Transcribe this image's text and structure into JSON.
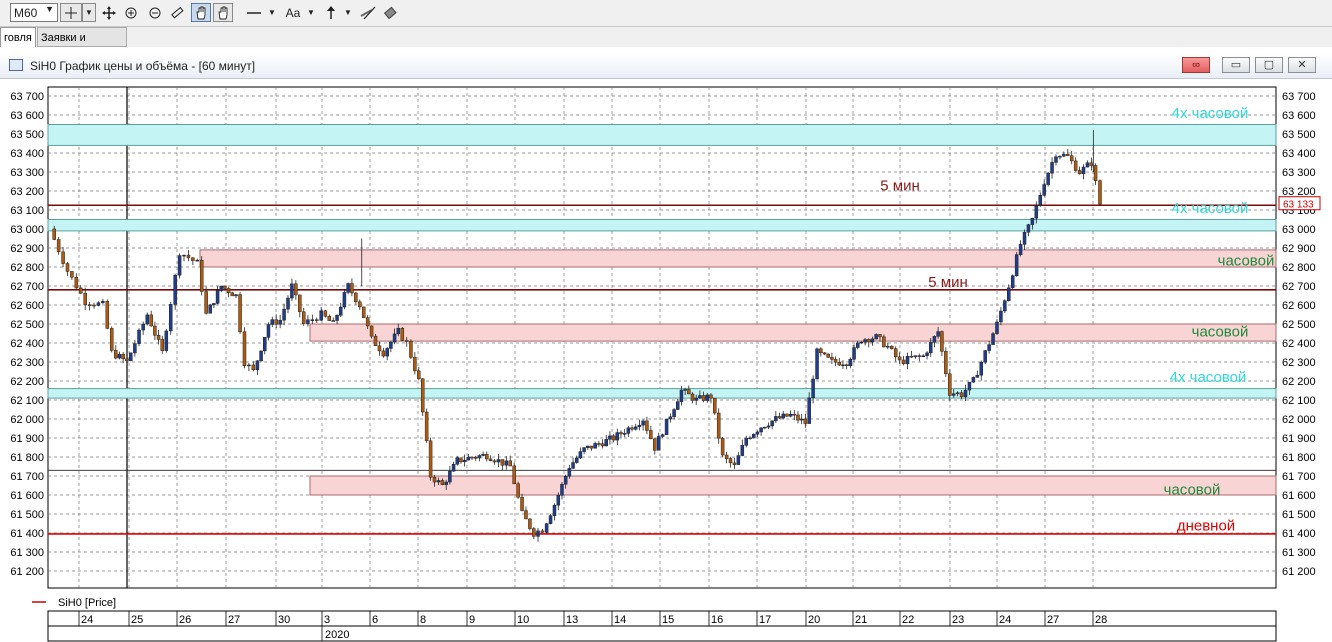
{
  "toolbar": {
    "interval": "M60",
    "text_tool": "Aa"
  },
  "tabs": [
    {
      "label": "говля"
    },
    {
      "label": "Заявки и сделки"
    }
  ],
  "window": {
    "title": "SiH0 График цены и объёма - [60 минут]"
  },
  "legend": {
    "label": "SiH0 [Price]",
    "color": "#cc0000"
  },
  "colors": {
    "hourly_zone_fill": "#f9d4d4",
    "four_hour_zone_fill": "#c5f4f4",
    "hourly_label": "#1e8a3e",
    "four_hour_label": "#2fd9d9",
    "five_min_label": "#8a1a1a",
    "daily_label": "#e00000",
    "bull_candle": "#1f3d8c",
    "bear_candle": "#b05a10",
    "price_badge": "#cc0000"
  },
  "chart_data": {
    "type": "candlestick",
    "title": "SiH0 График цены и объёма - [60 минут]",
    "series_name": "SiH0 [Price]",
    "ylim": [
      61100,
      63750
    ],
    "y_ticks": [
      "63 700",
      "63 600",
      "63 500",
      "63 400",
      "63 300",
      "63 200",
      "63 100",
      "63 000",
      "62 900",
      "62 800",
      "62 700",
      "62 600",
      "62 500",
      "62 400",
      "62 300",
      "62 200",
      "62 100",
      "62 000",
      "61 900",
      "61 800",
      "61 700",
      "61 600",
      "61 500",
      "61 400",
      "61 300",
      "61 200"
    ],
    "y_tick_values": [
      63700,
      63600,
      63500,
      63400,
      63300,
      63200,
      63100,
      63000,
      62900,
      62800,
      62700,
      62600,
      62500,
      62400,
      62300,
      62200,
      62100,
      62000,
      61900,
      61800,
      61700,
      61600,
      61500,
      61400,
      61300,
      61200
    ],
    "x_day_labels": [
      "24",
      "25",
      "26",
      "27",
      "30",
      "3",
      "6",
      "8",
      "9",
      "10",
      "13",
      "14",
      "15",
      "16",
      "17",
      "20",
      "21",
      "22",
      "23",
      "24",
      "27",
      "28"
    ],
    "x_year_label": "2020",
    "last_price": "63 133",
    "last_price_value": 63133,
    "close_path": [
      [
        0,
        63000
      ],
      [
        0.6,
        62780
      ],
      [
        1.2,
        62620
      ],
      [
        1.8,
        62600
      ],
      [
        2.1,
        62350
      ],
      [
        2.6,
        62300
      ],
      [
        3.3,
        62550
      ],
      [
        3.8,
        62350
      ],
      [
        4.4,
        62880
      ],
      [
        5.0,
        62820
      ],
      [
        5.3,
        62550
      ],
      [
        5.8,
        62700
      ],
      [
        6.3,
        62650
      ],
      [
        6.6,
        62300
      ],
      [
        6.9,
        62250
      ],
      [
        7.4,
        62500
      ],
      [
        7.8,
        62520
      ],
      [
        8.2,
        62700
      ],
      [
        8.6,
        62500
      ],
      [
        9.2,
        62550
      ],
      [
        9.6,
        62500
      ],
      [
        10.1,
        62700
      ],
      [
        10.5,
        62600
      ],
      [
        10.9,
        62420
      ],
      [
        11.3,
        62350
      ],
      [
        11.8,
        62460
      ],
      [
        12.1,
        62400
      ],
      [
        12.5,
        62200
      ],
      [
        12.9,
        61700
      ],
      [
        13.3,
        61650
      ],
      [
        13.8,
        61780
      ],
      [
        14.3,
        61800
      ],
      [
        14.8,
        61810
      ],
      [
        15.2,
        61780
      ],
      [
        15.6,
        61750
      ],
      [
        16.0,
        61500
      ],
      [
        16.4,
        61400
      ],
      [
        16.7,
        61420
      ],
      [
        17.1,
        61550
      ],
      [
        17.6,
        61750
      ],
      [
        18.1,
        61840
      ],
      [
        18.6,
        61870
      ],
      [
        19.1,
        61900
      ],
      [
        19.6,
        61950
      ],
      [
        20.1,
        62000
      ],
      [
        20.5,
        61850
      ],
      [
        20.9,
        61980
      ],
      [
        21.4,
        62150
      ],
      [
        21.9,
        62100
      ],
      [
        22.4,
        62120
      ],
      [
        22.8,
        61800
      ],
      [
        23.2,
        61750
      ],
      [
        23.6,
        61900
      ],
      [
        24.1,
        61960
      ],
      [
        24.6,
        62000
      ],
      [
        25.1,
        62020
      ],
      [
        25.6,
        61980
      ],
      [
        26.0,
        62350
      ],
      [
        26.5,
        62300
      ],
      [
        27.0,
        62300
      ],
      [
        27.5,
        62420
      ],
      [
        28.0,
        62430
      ],
      [
        28.4,
        62380
      ],
      [
        28.8,
        62300
      ],
      [
        29.2,
        62320
      ],
      [
        29.6,
        62330
      ],
      [
        30.1,
        62460
      ],
      [
        30.5,
        62140
      ],
      [
        30.9,
        62130
      ],
      [
        31.3,
        62200
      ],
      [
        31.7,
        62350
      ],
      [
        32.1,
        62500
      ],
      [
        32.5,
        62700
      ],
      [
        32.9,
        62920
      ],
      [
        33.3,
        63050
      ],
      [
        33.7,
        63250
      ],
      [
        34.1,
        63400
      ],
      [
        34.5,
        63380
      ],
      [
        34.9,
        63300
      ],
      [
        35.3,
        63350
      ],
      [
        35.6,
        63133
      ]
    ],
    "levels": [
      {
        "type": "zone",
        "timeframe": "4h",
        "y1": 63440,
        "y2": 63550,
        "label": "4х часовой",
        "label_y": 63610
      },
      {
        "type": "zone",
        "timeframe": "4h",
        "y1": 62990,
        "y2": 63050,
        "label": "4х часовой",
        "label_y": 63110
      },
      {
        "type": "zone",
        "timeframe": "1h",
        "y1": 62800,
        "y2": 62890,
        "label": "часовой",
        "label_y": 62835
      },
      {
        "type": "zone",
        "timeframe": "1h",
        "y1": 62410,
        "y2": 62500,
        "label": "часовой",
        "label_y": 62460
      },
      {
        "type": "zone",
        "timeframe": "4h",
        "y1": 62110,
        "y2": 62160,
        "label": "4х часовой",
        "label_y": 62220
      },
      {
        "type": "zone",
        "timeframe": "1h",
        "y1": 61600,
        "y2": 61700,
        "label": "часовой",
        "label_y": 61630
      },
      {
        "type": "line",
        "timeframe": "5m",
        "y": 63125,
        "label": "5 мин",
        "label_y": 63230
      },
      {
        "type": "line",
        "timeframe": "5m",
        "y": 62680,
        "label": "5 мин",
        "label_y": 62720
      },
      {
        "type": "line",
        "timeframe": "1d",
        "y": 61395,
        "label": "дневной",
        "label_y": 61440
      }
    ]
  }
}
